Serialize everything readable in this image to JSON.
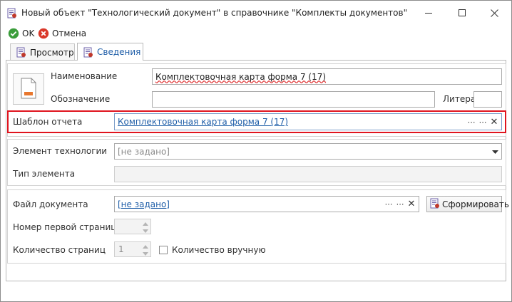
{
  "window": {
    "title": "Новый объект \"Технологический документ\" в справочнике \"Комплекты документов\""
  },
  "toolbar": {
    "ok_label": "OK",
    "cancel_label": "Отмена"
  },
  "tabs": [
    {
      "label": "Просмотр",
      "active": false
    },
    {
      "label": "Сведения",
      "active": true
    }
  ],
  "header_group": {
    "name_label": "Наименование",
    "name_value": "Комплектовочная карта форма 7 (17)",
    "designation_label": "Обозначение",
    "designation_value": "",
    "litera_label": "Литера",
    "litera_value": ""
  },
  "template": {
    "label": "Шаблон отчета",
    "value": "Комплектовочная карта форма 7 (17)"
  },
  "technology_group": {
    "element_label": "Элемент технологии",
    "element_value": "[не задано]",
    "type_label": "Тип элемента",
    "type_value": ""
  },
  "document_group": {
    "file_label": "Файл документа",
    "file_value": "[не задано]",
    "generate_label": "Сформировать",
    "first_page_label": "Номер первой страницы",
    "first_page_value": "",
    "page_count_label": "Количество страниц",
    "page_count_value": "1",
    "manual_count_label": "Количество вручную",
    "manual_count_checked": false
  },
  "colors": {
    "accent_link": "#1f5ea8",
    "highlight_border": "#e0141e",
    "ok_green": "#3a9d3a",
    "cancel_red": "#d9382a"
  },
  "icons": {
    "window": "document-icon",
    "ok": "check-circle-icon",
    "cancel": "x-circle-icon",
    "preview_tab": "document-icon",
    "info_tab": "document-icon",
    "file_preview": "file-thumbnail-icon",
    "generate": "document-icon"
  }
}
